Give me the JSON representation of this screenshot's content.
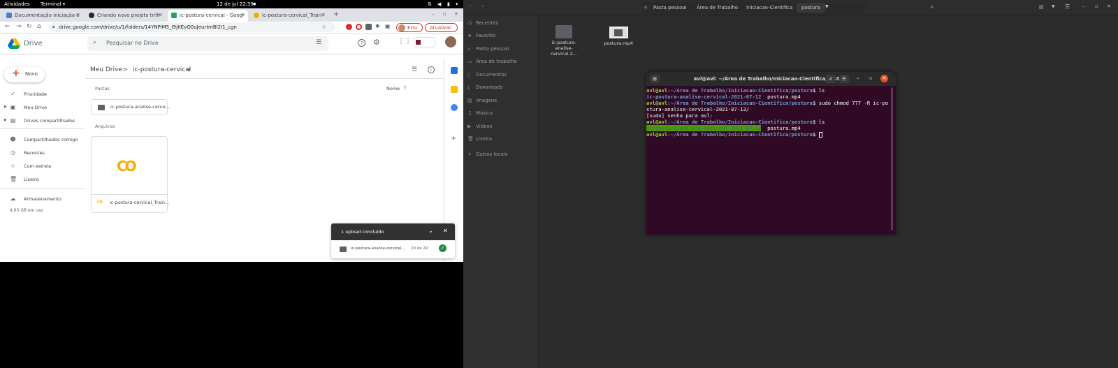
{
  "topbar": {
    "activities": "Atividades",
    "app_menu": "Terminal ▾",
    "clock": "12 de jul  22:39",
    "dot": "●"
  },
  "chrome": {
    "tabs": [
      {
        "label": "Documentação iniciação c",
        "color": "#4e7bd8"
      },
      {
        "label": "Criando novo projeto trilh",
        "color": "#24292e"
      },
      {
        "label": "ic-postura-cervical - Goog",
        "color": "#1fa463"
      },
      {
        "label": "ic-postura-cervical_Train",
        "color": "#f9ab00"
      }
    ],
    "new_tab": "+",
    "url": "drive.google.com/drive/u/1/folders/14YNPiM5_I9jKEvQ0uJeurtmBl2I1_cgn",
    "error_chip": "Erro",
    "update_button": "Atualizar"
  },
  "drive": {
    "brand": "Drive",
    "search_placeholder": "Pesquisar no Drive",
    "new_button": "Novo",
    "sidebar": [
      {
        "label": "Prioridade",
        "icon": "check-circle-icon"
      },
      {
        "label": "Meu Drive",
        "icon": "my-drive-icon"
      },
      {
        "label": "Drives compartilhados",
        "icon": "shared-drives-icon"
      },
      {
        "label": "Compartilhados comigo",
        "icon": "people-icon"
      },
      {
        "label": "Recentes",
        "icon": "clock-icon"
      },
      {
        "label": "Com estrela",
        "icon": "star-icon"
      },
      {
        "label": "Lixeira",
        "icon": "trash-icon"
      },
      {
        "label": "Armazenamento",
        "icon": "cloud-icon"
      }
    ],
    "storage_used": "4,63 GB em uso",
    "breadcrumb_root": "Meu Drive",
    "breadcrumb_sep": ">",
    "breadcrumb_current": "ic-postura-cervical",
    "section_folders": "Pastas",
    "sort_label": "Nome",
    "folder_name": "ic-postura-analise-cervic...",
    "section_files": "Arquivos",
    "file_name": "ic-postura-cervical_Train...",
    "colab_logo": "CO",
    "upload_panel": {
      "title": "1 upload concluído",
      "item_name": "ic-postura-analise-cervical...",
      "item_progress": "29 de 29"
    }
  },
  "nautilus": {
    "breadcrumbs": [
      "Pasta pessoal",
      "Área de Trabalho",
      "Iniciacao-Cientifica",
      "postura"
    ],
    "sidebar": [
      {
        "label": "Recentes",
        "icon": "clock-icon"
      },
      {
        "label": "Favorito",
        "icon": "star-icon"
      },
      {
        "label": "Pasta pessoal",
        "icon": "home-icon"
      },
      {
        "label": "Área de trabalho",
        "icon": "desktop-icon"
      },
      {
        "label": "Documentos",
        "icon": "document-icon"
      },
      {
        "label": "Downloads",
        "icon": "download-icon"
      },
      {
        "label": "Imagens",
        "icon": "image-icon"
      },
      {
        "label": "Música",
        "icon": "music-icon"
      },
      {
        "label": "Vídeos",
        "icon": "video-icon"
      },
      {
        "label": "Lixeira",
        "icon": "trash-icon"
      },
      {
        "label": "Outros locais",
        "icon": "plus-icon"
      }
    ],
    "files": [
      {
        "label": "ic-postura-analise-cervical-2..."
      },
      {
        "label": "postura.mp4"
      }
    ]
  },
  "terminal": {
    "title": "avl@avl: ~/Área de Trabalho/Iniciacao-Cientifica/postura",
    "prompt_user": "avl@avl",
    "prompt_path": ":~/Área de Trabalho/Iniciacao-Cientifica/postura",
    "prompt_dollar": "$ ",
    "cmd1": "ls",
    "out1a": "ic-postura-analise-cervical-2021-07-12",
    "out1b": "  postura.mp4",
    "cmd2": "sudo chmod 777 -R ic-po",
    "cmd2_cont": "stura-analise-cervical-2021-07-12/",
    "sudo_prompt": "[sudo] senha para avl:",
    "cmd3": "ls",
    "out3a": "ic-postura-analise-cervical-2021-07-12",
    "out3b": "  postura.mp4"
  }
}
